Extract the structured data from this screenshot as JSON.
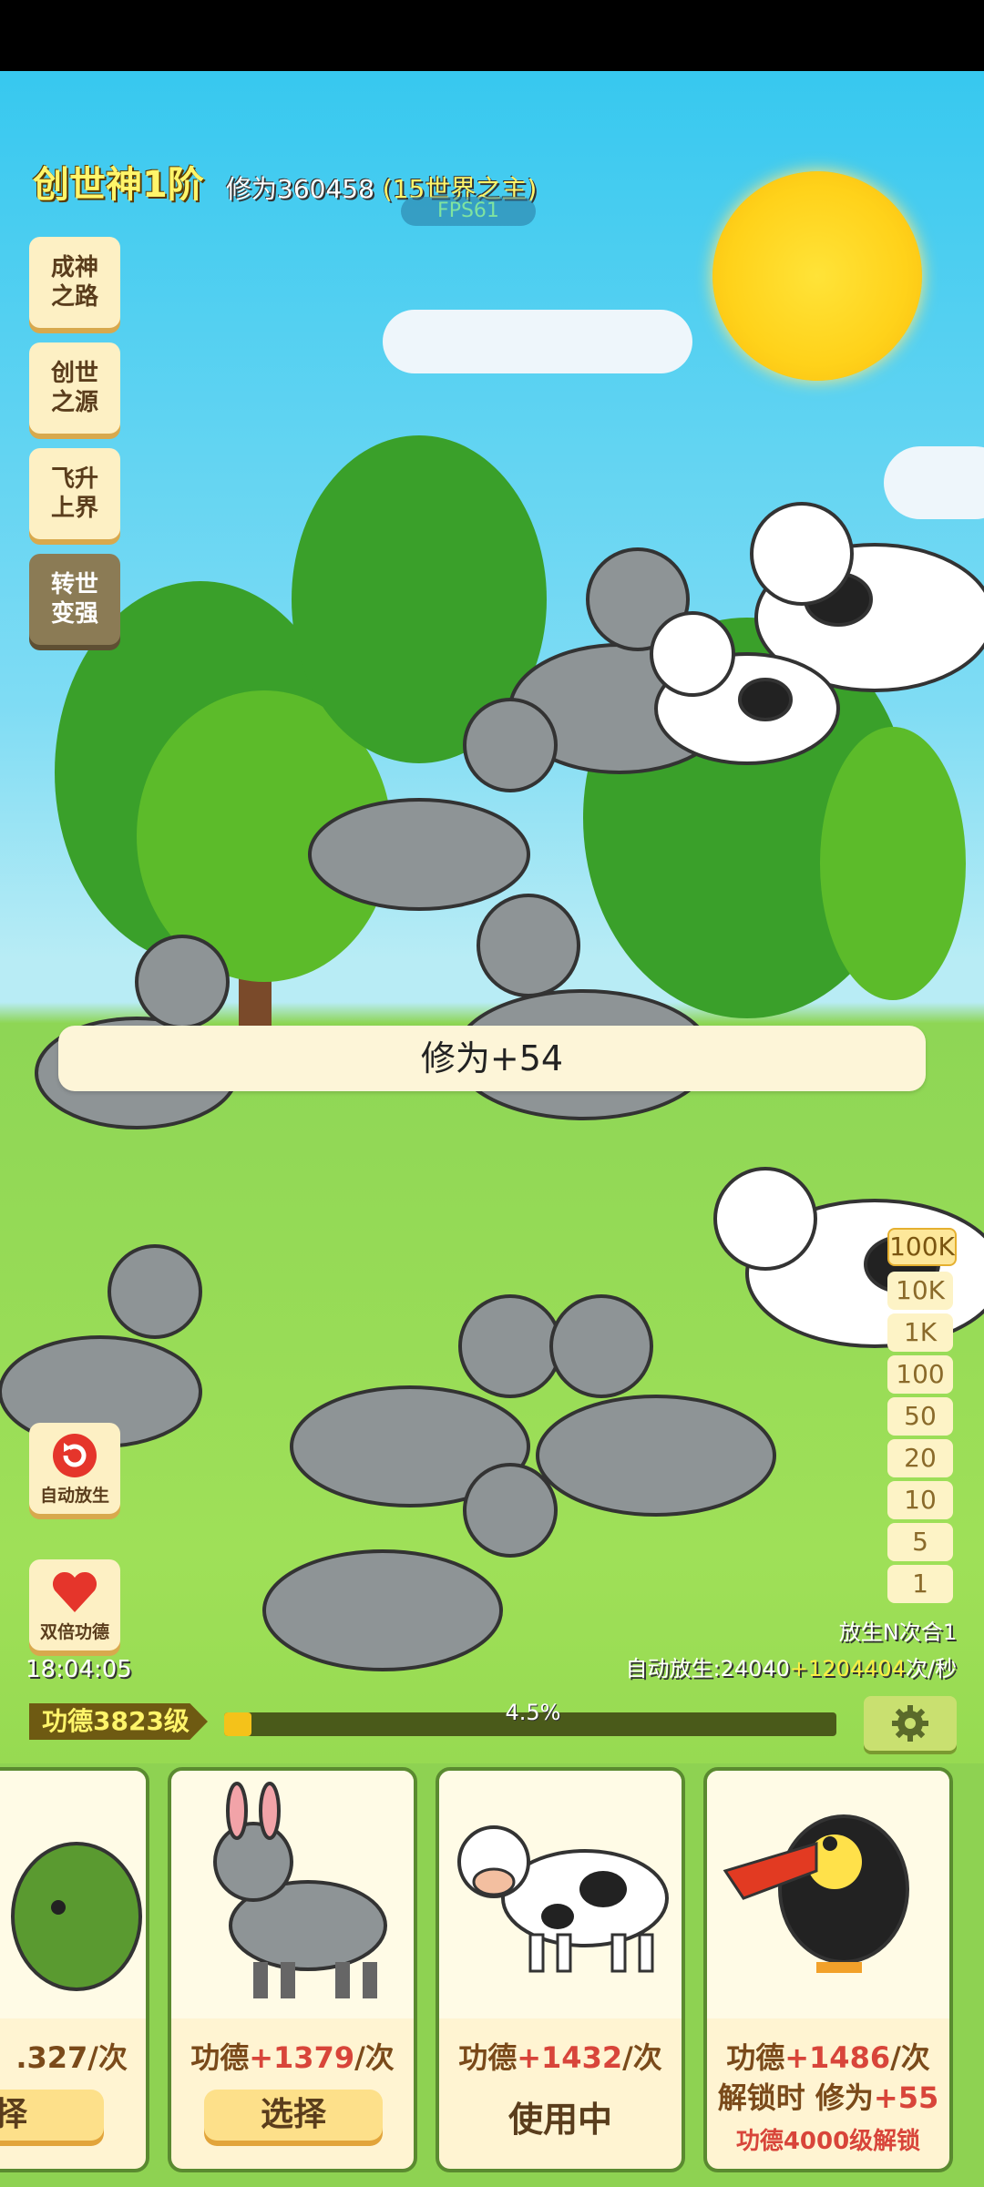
{
  "header": {
    "rank": "创世神1阶",
    "cultivation_label": "修为360458",
    "world_prefix": "(",
    "world_title": "15世界之主",
    "world_suffix": ")",
    "fps": "FPS61"
  },
  "sidebar": {
    "items": [
      {
        "label": "成神之路"
      },
      {
        "label": "创世之源"
      },
      {
        "label": "飞升上界"
      },
      {
        "label": "转世变强"
      }
    ]
  },
  "toast": "修为+54",
  "multipliers": {
    "options": [
      "100K",
      "10K",
      "1K",
      "100",
      "50",
      "20",
      "10",
      "5",
      "1"
    ],
    "selected": "100K"
  },
  "actions": {
    "auto_release": "自动放生",
    "double_merit": "双倍功德"
  },
  "clock": "18:04:05",
  "stats": {
    "release_combo": "放生N次合1",
    "auto_prefix": "自动放生:24040",
    "auto_bonus": "+1204404",
    "auto_suffix": "次/秒"
  },
  "merit": {
    "level": "功德3823级",
    "progress_text": "4.5%",
    "progress": 0.045
  },
  "cards": [
    {
      "merit_prefix": "",
      "merit_value": ".327",
      "merit_suffix": "/次",
      "button": "择",
      "animal": "crocodile-icon"
    },
    {
      "merit_prefix": "功德",
      "merit_value": "+1379",
      "merit_suffix": "/次",
      "button": "选择",
      "animal": "donkey-icon"
    },
    {
      "merit_prefix": "功德",
      "merit_value": "+1432",
      "merit_suffix": "/次",
      "status": "使用中",
      "animal": "cow-icon"
    },
    {
      "merit_prefix": "功德",
      "merit_value": "+1486",
      "merit_suffix": "/次",
      "unlock_prefix": "解锁时 修为",
      "unlock_value": "+55",
      "requirement": "功德4000级解锁",
      "animal": "toucan-icon"
    }
  ],
  "colors": {
    "accent_yellow": "#fff56a",
    "merit_red": "#d8453a",
    "card_bg": "#fff4d2"
  }
}
